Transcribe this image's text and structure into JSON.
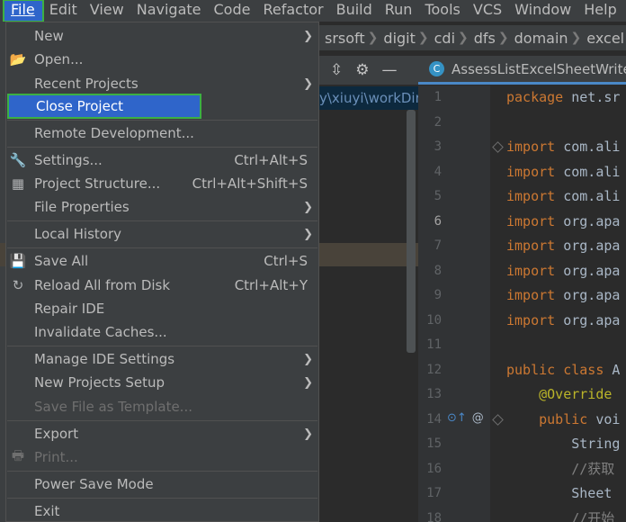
{
  "menubar": [
    "File",
    "Edit",
    "View",
    "Navigate",
    "Code",
    "Refactor",
    "Build",
    "Run",
    "Tools",
    "VCS",
    "Window",
    "Help"
  ],
  "breadcrumb": [
    "srsoft",
    "digit",
    "cdi",
    "dfs",
    "domain",
    "excel"
  ],
  "project_path": "y\\xiuyi\\workDir",
  "editor_tab": "AssessListExcelSheetWrite",
  "menu": {
    "new": "New",
    "open": "Open...",
    "recent_projects": "Recent Projects",
    "close_project": "Close Project",
    "remote_development": "Remote Development...",
    "settings": "Settings...",
    "settings_sc": "Ctrl+Alt+S",
    "project_structure": "Project Structure...",
    "project_structure_sc": "Ctrl+Alt+Shift+S",
    "file_properties": "File Properties",
    "local_history": "Local History",
    "save_all": "Save All",
    "save_all_sc": "Ctrl+S",
    "reload_all": "Reload All from Disk",
    "reload_all_sc": "Ctrl+Alt+Y",
    "repair_ide": "Repair IDE",
    "invalidate_caches": "Invalidate Caches...",
    "manage_ide_settings": "Manage IDE Settings",
    "new_projects_setup": "New Projects Setup",
    "save_file_as_template": "Save File as Template...",
    "export": "Export",
    "print": "Print...",
    "power_save_mode": "Power Save Mode",
    "exit": "Exit"
  },
  "code_lines": [
    {
      "n": "1",
      "kw": "package ",
      "rest": "net.sr"
    },
    {
      "n": "2",
      "kw": "",
      "rest": ""
    },
    {
      "n": "3",
      "kw": "import ",
      "rest": "com.ali"
    },
    {
      "n": "4",
      "kw": "import ",
      "rest": "com.ali"
    },
    {
      "n": "5",
      "kw": "import ",
      "rest": "com.ali"
    },
    {
      "n": "6",
      "kw": "import ",
      "rest": "org.apa"
    },
    {
      "n": "7",
      "kw": "import ",
      "rest": "org.apa"
    },
    {
      "n": "8",
      "kw": "import ",
      "rest": "org.apa"
    },
    {
      "n": "9",
      "kw": "import ",
      "rest": "org.apa"
    },
    {
      "n": "10",
      "kw": "import ",
      "rest": "org.apa"
    },
    {
      "n": "11",
      "kw": "",
      "rest": ""
    },
    {
      "n": "12",
      "kw": "public class ",
      "rest": "A"
    },
    {
      "n": "13",
      "kw": "",
      "rest": "    @Override"
    },
    {
      "n": "14",
      "kw": "    public ",
      "rest": "voi"
    },
    {
      "n": "15",
      "kw": "",
      "rest": "        String"
    },
    {
      "n": "16",
      "kw": "",
      "rest": "        //获取"
    },
    {
      "n": "17",
      "kw": "",
      "rest": "        Sheet"
    },
    {
      "n": "18",
      "kw": "",
      "rest": "        //开始"
    }
  ],
  "colors": {
    "accent": "#2f65ca",
    "highlight_border": "#3cb043",
    "keyword": "#cc7832"
  }
}
